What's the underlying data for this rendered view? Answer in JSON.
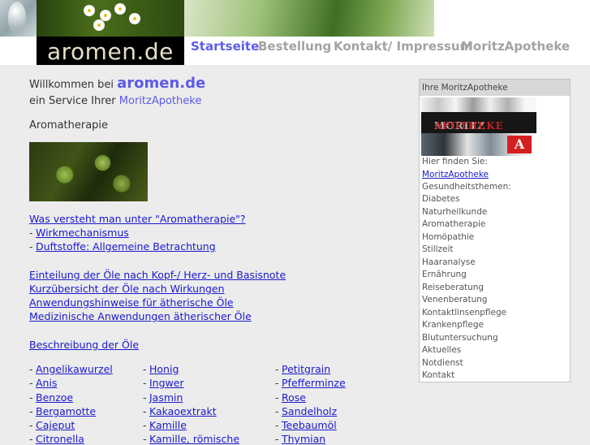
{
  "header": {
    "logo": "aromen.de",
    "nav": [
      {
        "label": "Startseite",
        "active": true
      },
      {
        "label": "Bestellung",
        "active": false
      },
      {
        "label": "Kontakt/ Impressum",
        "active": false
      },
      {
        "label": "MoritzApotheke",
        "active": false
      }
    ]
  },
  "intro": {
    "welcome_prefix": "Willkommen bei ",
    "brand": "aromen.de",
    "service_prefix": "ein Service Ihrer ",
    "service_link": "MoritzApotheke",
    "section_title": "Aromatherapie"
  },
  "links": {
    "what_is": "Was versteht man unter \"Aromatherapie\"?",
    "sub": [
      "Wirkmechanismus",
      "Duftstoffe: Allgemeine Betrachtung"
    ],
    "group2": [
      "Einteilung der Öle nach Kopf-/ Herz- und Basisnote",
      "Kurzübersicht der Öle nach Wirkungen",
      "Anwendungshinweise für ätherische Öle",
      "Medizinische Anwendungen ätherischer Öle"
    ],
    "description": "Beschreibung der Öle"
  },
  "oils": {
    "col1": [
      "Angelikawurzel",
      "Anis",
      "Benzoe",
      "Bergamotte",
      "Cajeput",
      "Citronella"
    ],
    "col2": [
      "Honig",
      "Ingwer",
      "Jasmin",
      "Kakaoextrakt",
      "Kamille",
      "Kamille, römische"
    ],
    "col3": [
      "Petitgrain",
      "Pfefferminze",
      "Rose",
      "Sandelholz",
      "Teebaumöl",
      "Thymian"
    ]
  },
  "sidebar": {
    "title": "Ihre MoritzApotheke",
    "banner_text": "MORITZ",
    "banner_suffix": "APOTHEKE",
    "logo_letter": "A",
    "found_here": "Hier finden Sie:",
    "link": "MoritzApotheke",
    "topics_title": "Gesundheitsthemen:",
    "topics": [
      "Diabetes",
      "Naturheilkunde",
      "Aromatherapie",
      "Homöpathie",
      "Stillzeit",
      "Haaranalyse",
      "Ernährung",
      "Reiseberatung",
      "Venenberatung",
      "Kontaktlinsenpflege",
      "Krankenpflege",
      "Blutuntersuchung",
      "Aktuelles",
      "Notdienst",
      "Kontakt"
    ]
  },
  "colors": {
    "accent": "#5b5be9",
    "link": "#1a1acc",
    "nav_inactive": "#a3a3a3",
    "background": "#ececec"
  }
}
